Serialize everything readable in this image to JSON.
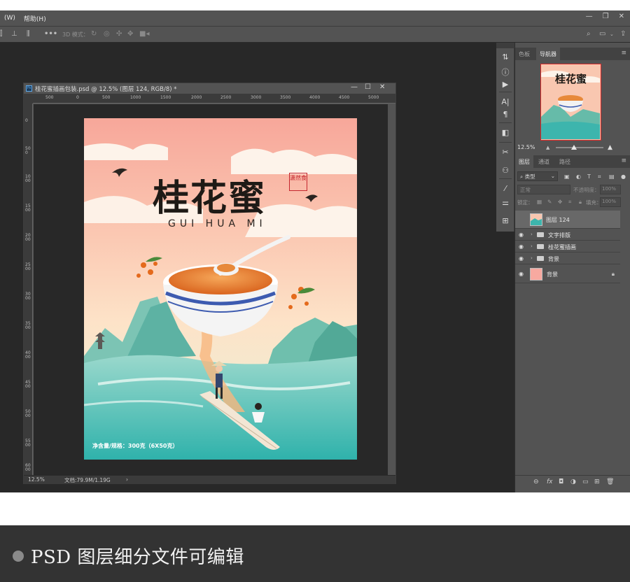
{
  "menubar": {
    "items": [
      "(W)",
      "帮助(H)"
    ],
    "window_buttons": [
      "—",
      "❐",
      "✕"
    ]
  },
  "optionsbar": {
    "mode3d_label": "3D 模式："
  },
  "document": {
    "title": "桂花蜜插画包装.psd @ 12.5% (图层 124, RGB/8) *",
    "ruler_top": [
      "500",
      "0",
      "500",
      "1000",
      "1500",
      "2000",
      "2500",
      "3000",
      "3500",
      "4000",
      "4500",
      "5000"
    ],
    "ruler_left": [
      "0",
      "500",
      "1000",
      "1500",
      "2000",
      "2500",
      "3000",
      "3500",
      "4000",
      "4500",
      "5000",
      "5500",
      "6000"
    ],
    "zoom": "12.5%",
    "doc_info": "文档:79.9M/1.19G",
    "window_buttons": [
      "—",
      "☐",
      "✕"
    ]
  },
  "artwork": {
    "title_cn": "桂花蜜",
    "title_pinyin": "GUI HUA MI",
    "seal_text": "潇然食",
    "net_content": "净含量/规格：300克（6X50克）"
  },
  "panels": {
    "top_tabs": [
      "色板",
      "导航器"
    ],
    "nav_thumb_title": "桂花蜜",
    "nav_zoom": "12.5%",
    "layer_tabs": [
      "图层",
      "通道",
      "路径"
    ],
    "filter_label": "类型",
    "blend_mode": "正常",
    "opacity_label": "不透明度：",
    "opacity_value": "100%",
    "lock_label": "锁定：",
    "fill_label": "填充：",
    "fill_value": "100%",
    "layers": [
      {
        "name": "图层 124",
        "type": "layer",
        "selected": true,
        "visible": false
      },
      {
        "name": "文字排版",
        "type": "group",
        "selected": false,
        "visible": true
      },
      {
        "name": "桂花蜜插画",
        "type": "group",
        "selected": false,
        "visible": true
      },
      {
        "name": "背景",
        "type": "group",
        "selected": false,
        "visible": true
      },
      {
        "name": "背景",
        "type": "background",
        "selected": false,
        "visible": true,
        "locked": true
      }
    ]
  },
  "caption": {
    "text": "PSD 图层细分文件可编辑"
  },
  "colors": {
    "ui_dark": "#282828",
    "ui_panel": "#535353",
    "bg_layer_swatch": "#f7a9a0",
    "seal_red": "#c4262e"
  }
}
